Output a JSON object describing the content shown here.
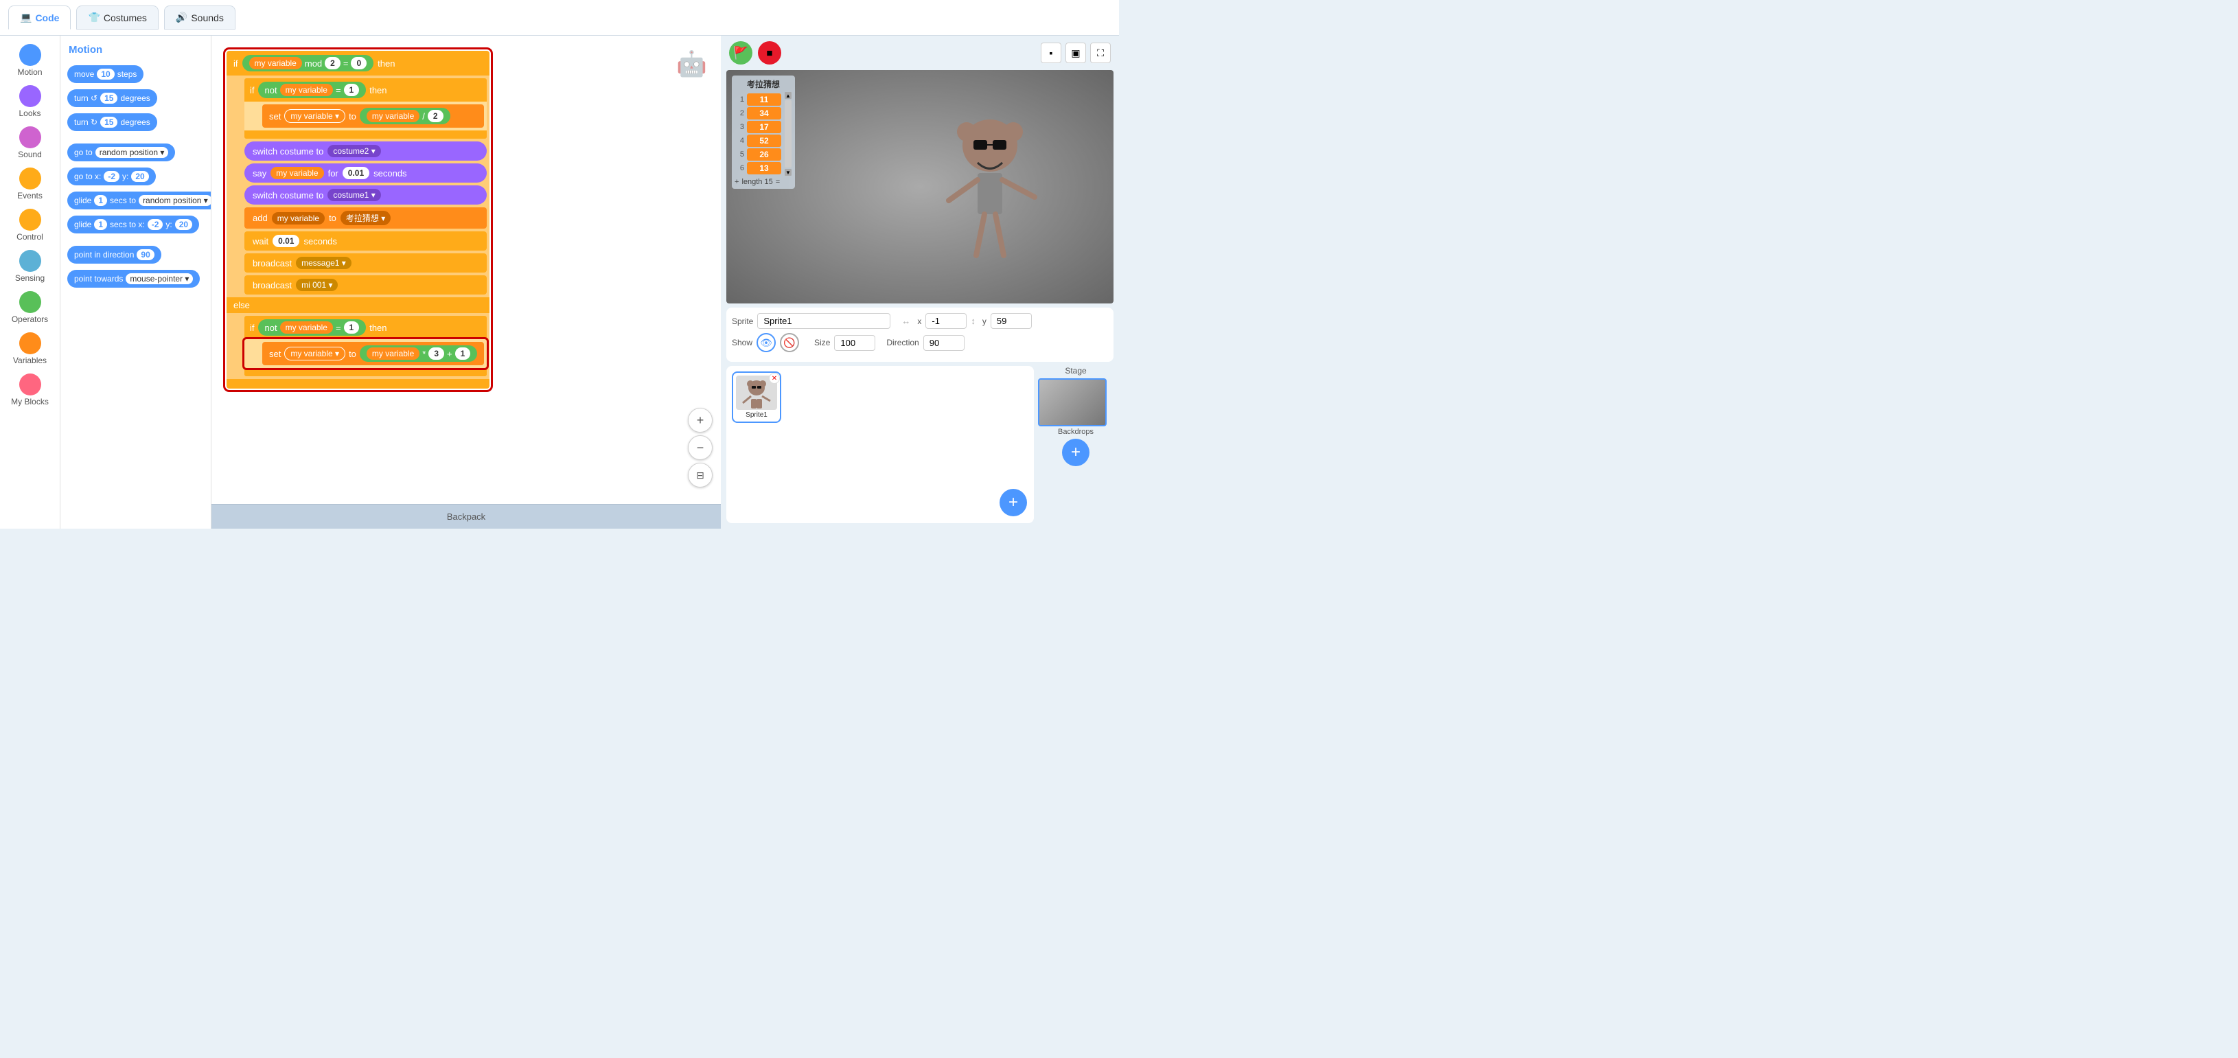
{
  "tabs": {
    "code": "Code",
    "costumes": "Costumes",
    "sounds": "Sounds"
  },
  "categories": [
    {
      "id": "motion",
      "label": "Motion",
      "color": "#4c97ff"
    },
    {
      "id": "looks",
      "label": "Looks",
      "color": "#9966ff"
    },
    {
      "id": "sound",
      "label": "Sound",
      "color": "#cf63cf"
    },
    {
      "id": "events",
      "label": "Events",
      "color": "#ffab19"
    },
    {
      "id": "control",
      "label": "Control",
      "color": "#ffab19"
    },
    {
      "id": "sensing",
      "label": "Sensing",
      "color": "#5cb1d6"
    },
    {
      "id": "operators",
      "label": "Operators",
      "color": "#59c059"
    },
    {
      "id": "variables",
      "label": "Variables",
      "color": "#ff8c1a"
    },
    {
      "id": "myblocks",
      "label": "My Blocks",
      "color": "#ff6680"
    }
  ],
  "blocks_panel": {
    "title": "Motion",
    "blocks": [
      {
        "label": "move",
        "val": "10",
        "suffix": "steps"
      },
      {
        "label": "turn ↺",
        "val": "15",
        "suffix": "degrees"
      },
      {
        "label": "turn ↻",
        "val": "15",
        "suffix": "degrees"
      },
      {
        "label": "go to",
        "val": "random position",
        "suffix": ""
      },
      {
        "label": "go to x:",
        "val": "-2",
        "suffix": "y:",
        "val2": "20"
      },
      {
        "label": "glide",
        "val": "1",
        "suffix": "secs to",
        "val3": "random position"
      },
      {
        "label": "glide",
        "val": "1",
        "suffix": "secs to x:",
        "val2": "-2",
        "suffix2": "y:",
        "val3": "20"
      },
      {
        "label": "point in direction",
        "val": "90",
        "suffix": ""
      },
      {
        "label": "point towards",
        "val": "mouse-pointer",
        "suffix": ""
      }
    ]
  },
  "workspace": {
    "backpack_label": "Backpack"
  },
  "stage": {
    "sprite_name": "Sprite1",
    "x": "-1",
    "y": "59",
    "size": "100",
    "direction": "90",
    "show": true
  },
  "variable_monitor": {
    "title": "考拉猜想",
    "rows": [
      {
        "num": "1",
        "val": "11"
      },
      {
        "num": "2",
        "val": "34"
      },
      {
        "num": "3",
        "val": "17"
      },
      {
        "num": "4",
        "val": "52"
      },
      {
        "num": "5",
        "val": "26"
      },
      {
        "num": "6",
        "val": "13"
      }
    ],
    "footer_plus": "+",
    "footer_label": "length 15",
    "footer_eq": "="
  },
  "script_blocks": {
    "if_condition": "my variable mod 2 = 0",
    "then_label": "then",
    "my_variable": "my variable",
    "mod_val": "2",
    "eq_val": "0",
    "not_label": "not",
    "eq1_val": "1",
    "set_to": "set",
    "to_label": "to",
    "div_val": "2",
    "switch_costume": "switch costume to",
    "costume2": "costume2",
    "say_label": "say",
    "for_label": "for",
    "seconds_val": "0.01",
    "seconds_label": "seconds",
    "costume1": "costume1",
    "add_label": "add",
    "wait_label": "wait",
    "wait_val": "0.01",
    "broadcast_label": "broadcast",
    "message1": "message1",
    "mi001": "mi 001",
    "else_label": "else",
    "set2_label": "set",
    "times_val": "3",
    "plus_val": "1"
  },
  "stage_section": {
    "label": "Stage"
  },
  "backdrops_label": "Backdrops"
}
